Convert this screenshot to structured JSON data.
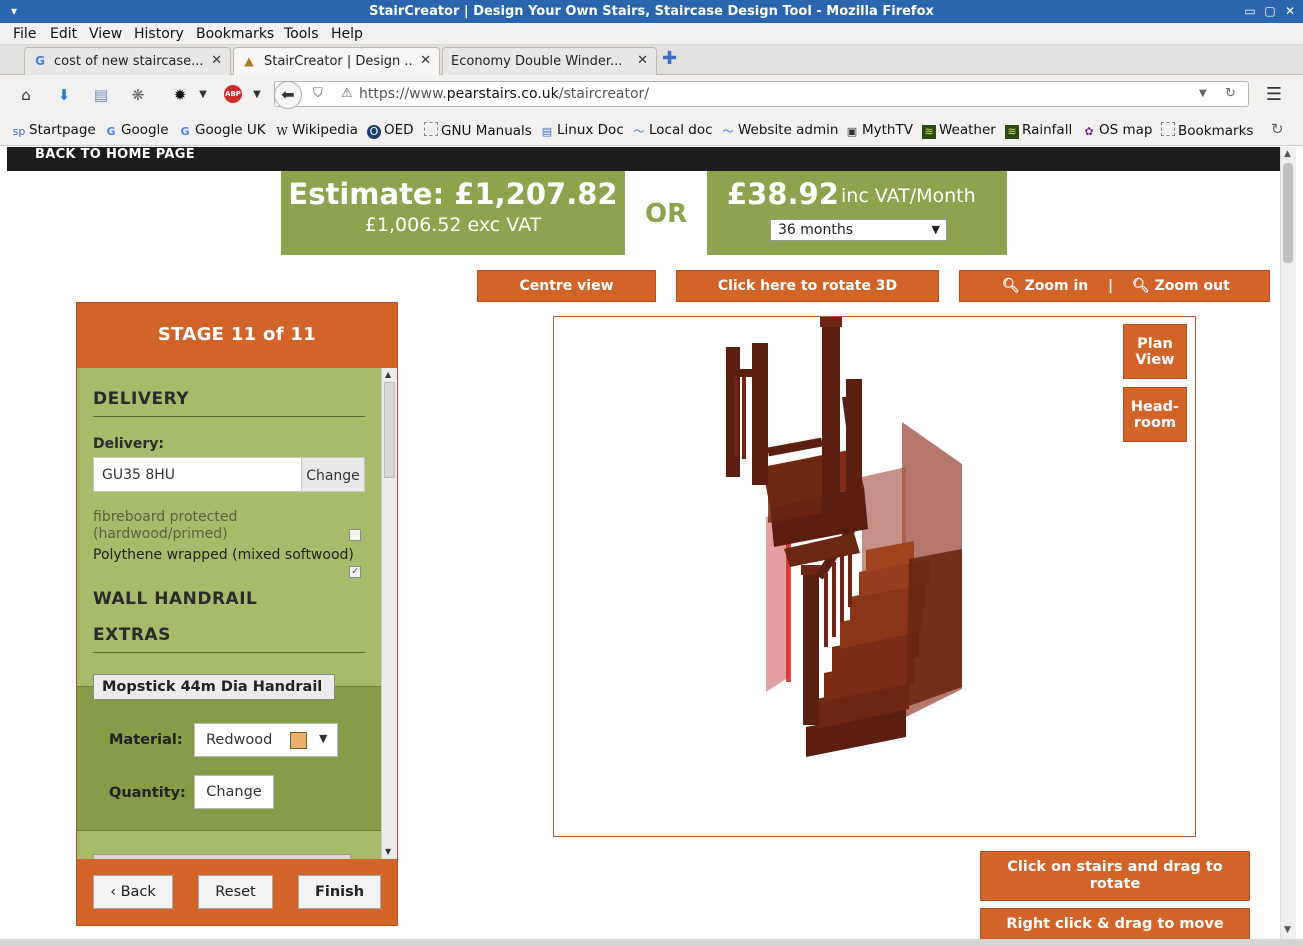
{
  "window": {
    "title": "StairCreator | Design Your Own Stairs, Staircase Design Tool - Mozilla Firefox"
  },
  "menu": [
    "File",
    "Edit",
    "View",
    "History",
    "Bookmarks",
    "Tools",
    "Help"
  ],
  "tabs": [
    {
      "label": "cost of new staircase...",
      "icon": "google-icon"
    },
    {
      "label": "StairCreator | Design ...",
      "icon": "staircreator-icon",
      "active": true
    },
    {
      "label": "Economy Double Winder...",
      "icon": "none"
    }
  ],
  "address": {
    "prefix": "https://www.",
    "domain": "pearstairs.co.uk",
    "path": "/staircreator/"
  },
  "bookmarks": [
    {
      "label": "Startpage",
      "icon": "sp"
    },
    {
      "label": "Google",
      "icon": "G"
    },
    {
      "label": "Google UK",
      "icon": "G"
    },
    {
      "label": "Wikipedia",
      "icon": "W"
    },
    {
      "label": "OED",
      "icon": "O"
    },
    {
      "label": "GNU Manuals",
      "icon": "folder"
    },
    {
      "label": "Linux Doc",
      "icon": "doc"
    },
    {
      "label": "Local doc",
      "icon": "wave"
    },
    {
      "label": "Website admin",
      "icon": "wave"
    },
    {
      "label": "MythTV",
      "icon": "tv"
    },
    {
      "label": "Weather",
      "icon": "weather"
    },
    {
      "label": "Rainfall",
      "icon": "rain"
    },
    {
      "label": "OS map",
      "icon": "os"
    },
    {
      "label": "Bookmarks",
      "icon": "folder"
    }
  ],
  "page": {
    "home_link": "BACK TO HOME PAGE",
    "estimate": {
      "label": "Estimate: £1,207.82",
      "exc_vat": "£1,006.52 exc VAT"
    },
    "or_label": "OR",
    "monthly": {
      "amount": "£38.92",
      "unit": "inc VAT/Month",
      "term": "36 months"
    },
    "toolbar": {
      "centre": "Centre view",
      "rotate": "Click here to rotate 3D",
      "zoom_in": "Zoom in",
      "zoom_sep": "|",
      "zoom_out": "Zoom out"
    },
    "stage": {
      "header": "STAGE 11 of 11",
      "delivery_heading": "DELIVERY",
      "delivery_label": "Delivery:",
      "postcode": "GU35 8HU",
      "change_label": "Change",
      "option_fibreboard": "fibreboard protected (hardwood/primed)",
      "option_polythene": "Polythene wrapped (mixed softwood)",
      "option_fibreboard_checked": false,
      "option_polythene_checked": true,
      "wall_handrail_heading": "WALL HANDRAIL",
      "extras_heading": "EXTRAS",
      "handrail_item": "Mopstick 44m Dia Handrail",
      "material_label": "Material:",
      "material_value": "Redwood",
      "quantity_label": "Quantity:",
      "quantity_button": "Change",
      "back": "‹ Back",
      "reset": "Reset",
      "finish": "Finish"
    },
    "viewer": {
      "plan_view": "Plan View",
      "headroom": "Head-room"
    },
    "help": {
      "drag_rotate": "Click on stairs and drag to rotate",
      "drag_move": "Right click & drag to move"
    }
  },
  "colors": {
    "accent_orange": "#d2642a",
    "price_green": "#8ea34e",
    "panel_green": "#a7bc6a",
    "titlebar_blue": "#2a66ad"
  }
}
